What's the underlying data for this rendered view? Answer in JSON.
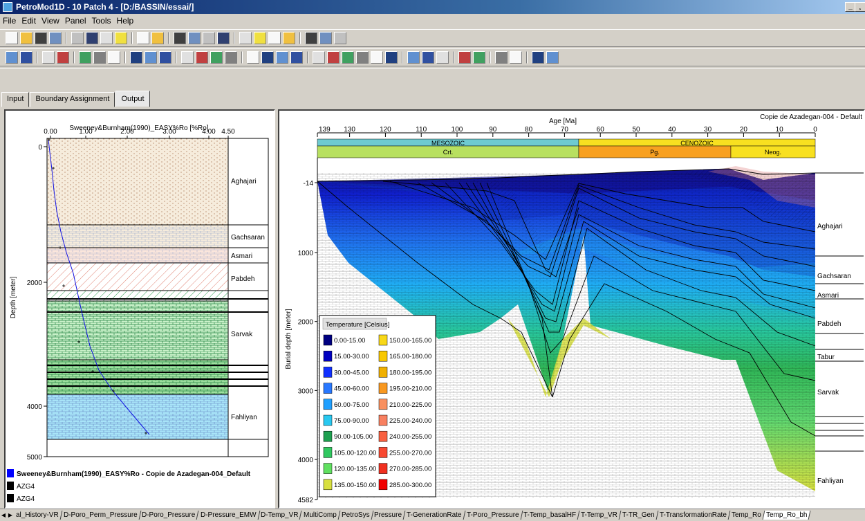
{
  "window": {
    "title": "PetroMod1D - 10 Patch 4 - [D:/BASSIN/essai/]",
    "min_label": "_",
    "max_label": "¸"
  },
  "menu": [
    "File",
    "Edit",
    "View",
    "Panel",
    "Tools",
    "Help"
  ],
  "tabs": {
    "input": "Input",
    "boundary": "Boundary Assignment",
    "output": "Output"
  },
  "left": {
    "title": "Sweeney&Burnham(1990)_EASY%Ro [%Ro]",
    "ylabel": "Depth [meter]",
    "xticks": [
      "0.00",
      "1.00",
      "2.00",
      "3.00",
      "4.00",
      "4.50"
    ],
    "yticks": [
      "0",
      "2000",
      "4000",
      "5000"
    ],
    "layers": [
      "Aghajari",
      "Gachsaran",
      "Asmari",
      "Pabdeh",
      "Sarvak",
      "Fahliyan"
    ],
    "legend": [
      "Sweeney&Burnham(1990)_EASY%Ro - Copie de Azadegan-004_Default",
      "AZG4",
      "AZG4"
    ]
  },
  "right": {
    "xlabel": "Age [Ma]",
    "scenario": "Copie de Azadegan-004 - Default",
    "ylabel": "Burial depth [meter]",
    "xticks": [
      "139",
      "130",
      "120",
      "110",
      "100",
      "90",
      "80",
      "70",
      "60",
      "50",
      "40",
      "30",
      "20",
      "10",
      "0"
    ],
    "yticks": [
      "-14",
      "1000",
      "2000",
      "3000",
      "4000",
      "4582"
    ],
    "eras": [
      "MESOZOIC",
      "CENOZOIC"
    ],
    "periods": [
      "Crt.",
      "Pg.",
      "Neog."
    ],
    "layers": [
      "Aghajari",
      "Gachsaran",
      "Asmari",
      "Pabdeh",
      "Tabur",
      "Sarvak",
      "Fahliyan"
    ]
  },
  "legend": {
    "title": "Temperature [Celsius]",
    "items": [
      {
        "label": "0.00-15.00",
        "color": "#000080"
      },
      {
        "label": "15.00-30.00",
        "color": "#0000c0"
      },
      {
        "label": "30.00-45.00",
        "color": "#1030ff"
      },
      {
        "label": "45.00-60.00",
        "color": "#2878ff"
      },
      {
        "label": "60.00-75.00",
        "color": "#20a0ff"
      },
      {
        "label": "75.00-90.00",
        "color": "#28c8f0"
      },
      {
        "label": "90.00-105.00",
        "color": "#1ea050"
      },
      {
        "label": "105.00-120.00",
        "color": "#30c860"
      },
      {
        "label": "120.00-135.00",
        "color": "#60e060"
      },
      {
        "label": "135.00-150.00",
        "color": "#d8e040"
      },
      {
        "label": "150.00-165.00",
        "color": "#f8d818"
      },
      {
        "label": "165.00-180.00",
        "color": "#f8c800"
      },
      {
        "label": "180.00-195.00",
        "color": "#f0b000"
      },
      {
        "label": "195.00-210.00",
        "color": "#f89820"
      },
      {
        "label": "210.00-225.00",
        "color": "#f89060"
      },
      {
        "label": "225.00-240.00",
        "color": "#f88060"
      },
      {
        "label": "240.00-255.00",
        "color": "#f86040"
      },
      {
        "label": "255.00-270.00",
        "color": "#f84830"
      },
      {
        "label": "270.00-285.00",
        "color": "#f03020"
      },
      {
        "label": "285.00-300.00",
        "color": "#f00000"
      }
    ]
  },
  "bottom_tabs": [
    "al_History-VR",
    "D-Poro_Perm_Pressure",
    "D-Poro_Pressure",
    "D-Pressure_EMW",
    "D-Temp_VR",
    "MultiComp",
    "PetroSys",
    "Pressure",
    "T-GenerationRate",
    "T-Poro_Pressure",
    "T-Temp_basalHF",
    "T-Temp_VR",
    "T-TR_Gen",
    "T-TransformationRate",
    "Temp_Ro",
    "Temp_Ro_bh"
  ]
}
